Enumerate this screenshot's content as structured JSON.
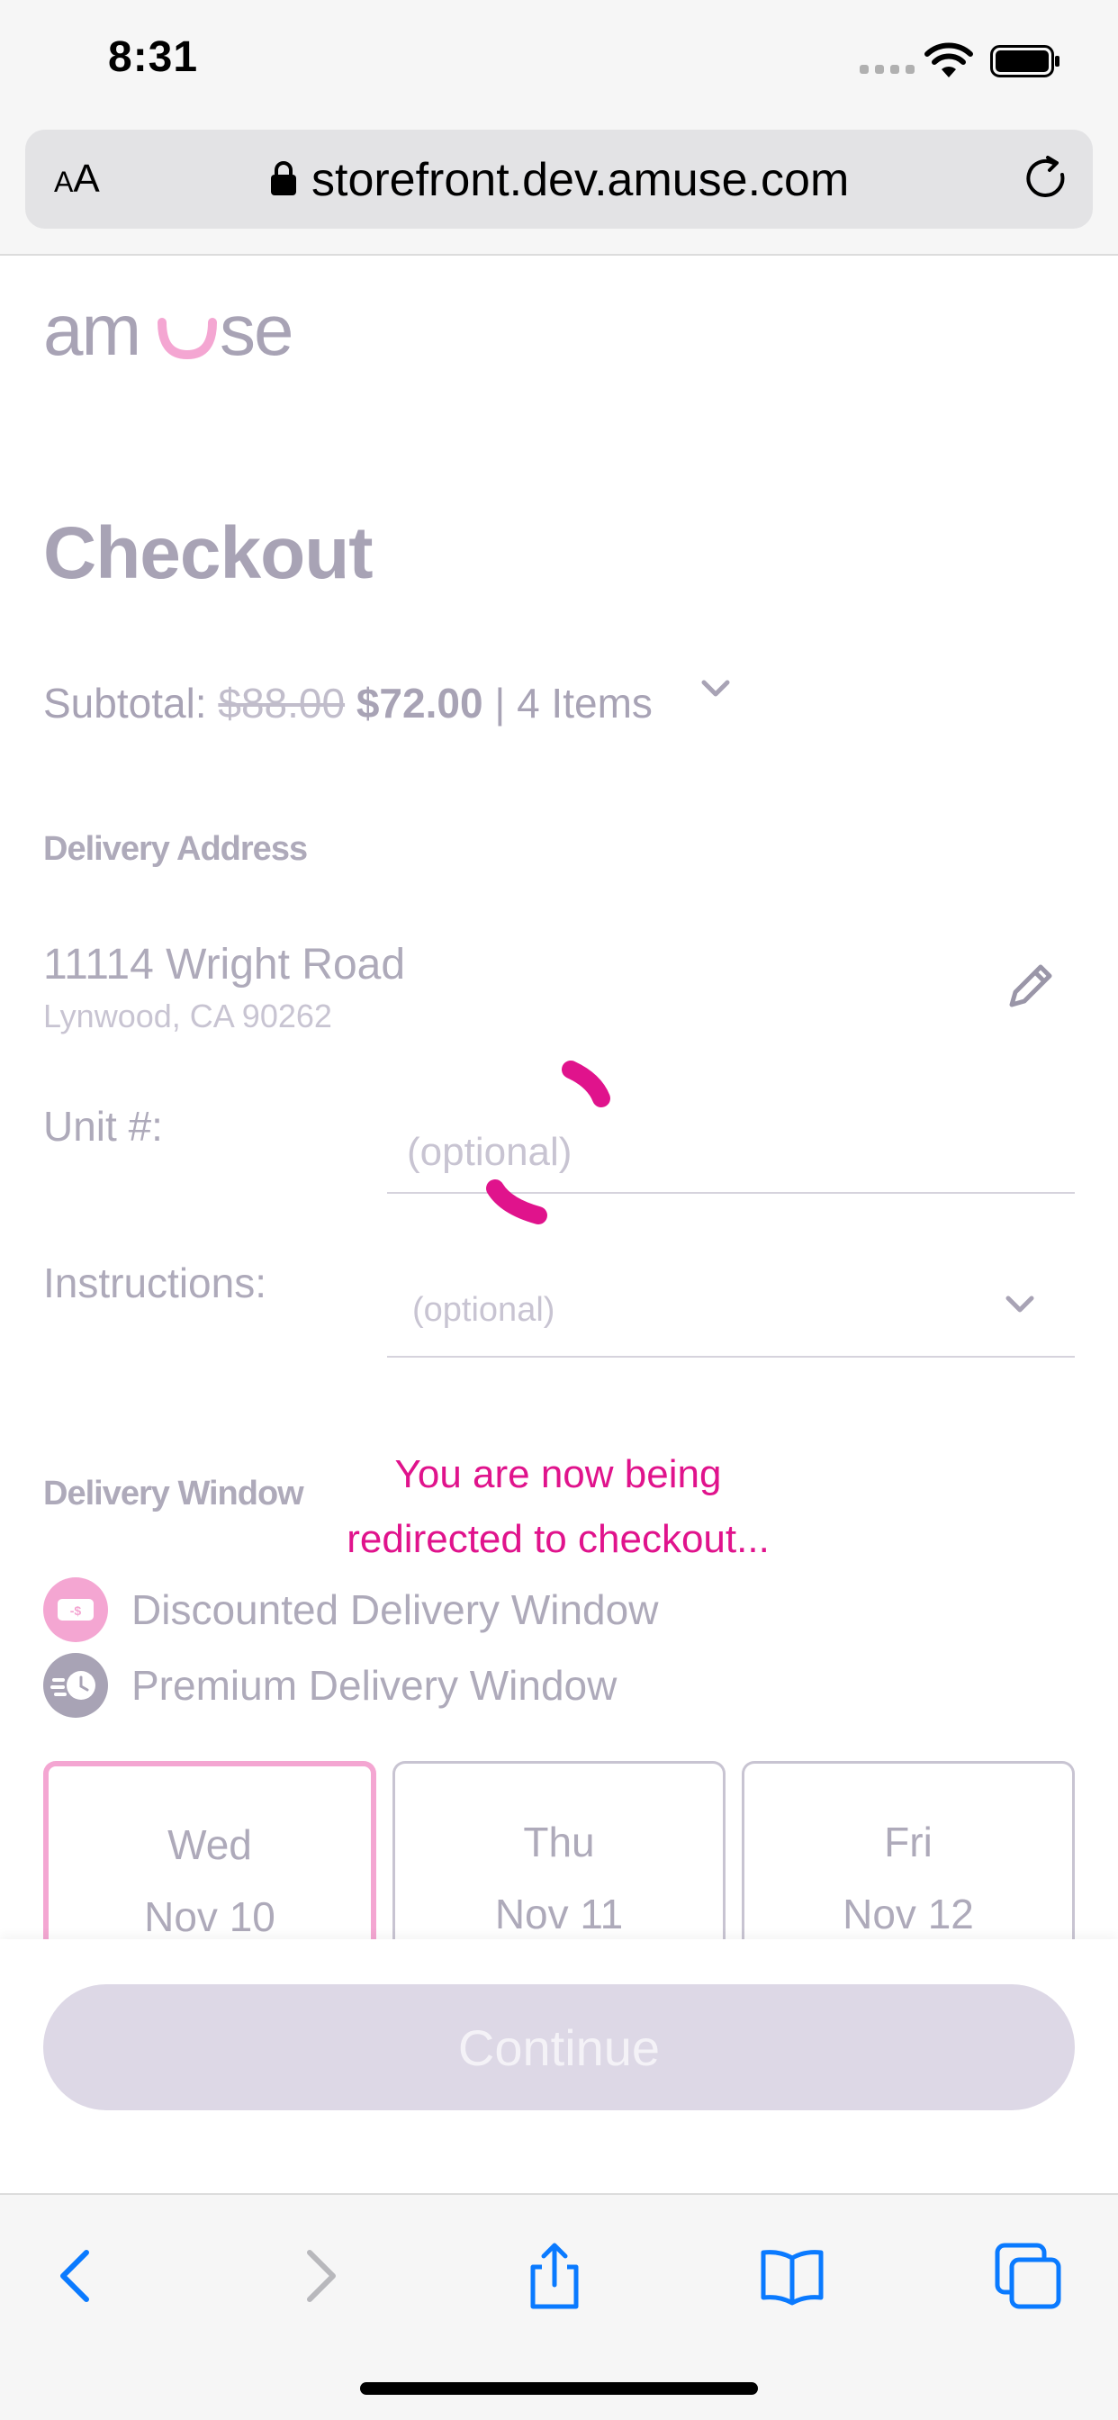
{
  "status_bar": {
    "time": "8:31"
  },
  "browser": {
    "text_size_label_small": "A",
    "text_size_label_large": "A",
    "url": "storefront.dev.amuse.com"
  },
  "brand": {
    "logo_text": "amuse",
    "accent_color": "#e0138c",
    "light_accent": "#f4a6d2"
  },
  "checkout": {
    "title": "Checkout",
    "subtotal_label": "Subtotal:",
    "original_price": "$88.00",
    "discounted_price": "$72.00",
    "separator": "|",
    "items_count": "4 Items"
  },
  "delivery_address": {
    "section_label": "Delivery Address",
    "street": "11114 Wright Road",
    "city_line": "Lynwood, CA 90262"
  },
  "form": {
    "unit_label": "Unit #:",
    "unit_placeholder": "(optional)",
    "instructions_label": "Instructions:",
    "instructions_value": "(optional)"
  },
  "overlay": {
    "redirect_line1": "You are now being",
    "redirect_line2": "redirected to checkout..."
  },
  "delivery_window": {
    "section_label": "Delivery Window",
    "legend": [
      {
        "label": "Discounted Delivery Window",
        "icon": "discount-tag-icon",
        "color": "#f4a6d2"
      },
      {
        "label": "Premium Delivery Window",
        "icon": "fast-clock-icon",
        "color": "#a8a3b5"
      }
    ],
    "days": [
      {
        "day": "Wed",
        "date": "Nov 10",
        "selected": true
      },
      {
        "day": "Thu",
        "date": "Nov 11",
        "selected": false
      },
      {
        "day": "Fri",
        "date": "Nov 12",
        "selected": false
      }
    ]
  },
  "actions": {
    "continue_label": "Continue"
  }
}
